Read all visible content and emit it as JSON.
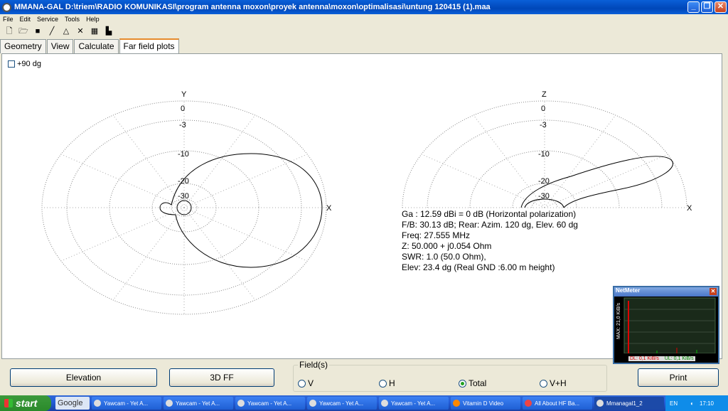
{
  "window": {
    "title": "MMANA-GAL D:\\triem\\RADIO KOMUNIKASI\\program antenna moxon\\proyek antenna\\moxon\\optimalisasi\\untung 120415 (1).maa"
  },
  "menu": [
    "File",
    "Edit",
    "Service",
    "Tools",
    "Help"
  ],
  "toolbar_icons": [
    "new-file-icon",
    "open-folder-icon",
    "save-icon",
    "line-icon",
    "triangle-icon",
    "tools-icon",
    "calculator-icon",
    "chart-icon"
  ],
  "tabs": [
    "Geometry",
    "View",
    "Calculate",
    "Far field plots"
  ],
  "active_tab": "Far field plots",
  "plot": {
    "checkbox_label": "+90 dg",
    "azimuth": {
      "y_axis": "Y",
      "x_axis": "X",
      "rings": [
        "0",
        "-3",
        "-10",
        "-20",
        "-30"
      ]
    },
    "elevation": {
      "z_axis": "Z",
      "x_axis": "X",
      "rings": [
        "0",
        "-3",
        "-10",
        "-20",
        "-30"
      ]
    },
    "info": [
      "Ga : 12.59 dBi = 0 dB  (Horizontal polarization)",
      "F/B: 30.13 dB; Rear: Azim. 120 dg,  Elev. 60 dg",
      "Freq: 27.555 MHz",
      "Z: 50.000 + j0.054 Ohm",
      "SWR: 1.0 (50.0 Ohm),",
      "Elev: 23.4 dg (Real GND  :6.00 m height)"
    ]
  },
  "netmeter": {
    "title": "NetMeter",
    "max_label": "MAX: 21,0 KiB/s",
    "dl": "DL: 0,1 KiB/s",
    "ul": "UL: 0,1 KiB/s"
  },
  "bottom": {
    "elevation_button": "Elevation",
    "ff3d_button": "3D FF",
    "field_legend": "Field(s)",
    "radios": [
      "V",
      "H",
      "Total",
      "V+H"
    ],
    "radio_selected": "Total",
    "print_button": "Print"
  },
  "taskbar": {
    "start": "start",
    "google": "Google",
    "tasks": [
      "Yawcam - Yet A...",
      "Yawcam - Yet A...",
      "Yawcam - Yet A...",
      "Yawcam - Yet A...",
      "Yawcam - Yet A...",
      "Vitamin D Video",
      "All About HF Ba...",
      "Mmanagal1_2"
    ],
    "lang": "EN",
    "clock": "17:10"
  }
}
